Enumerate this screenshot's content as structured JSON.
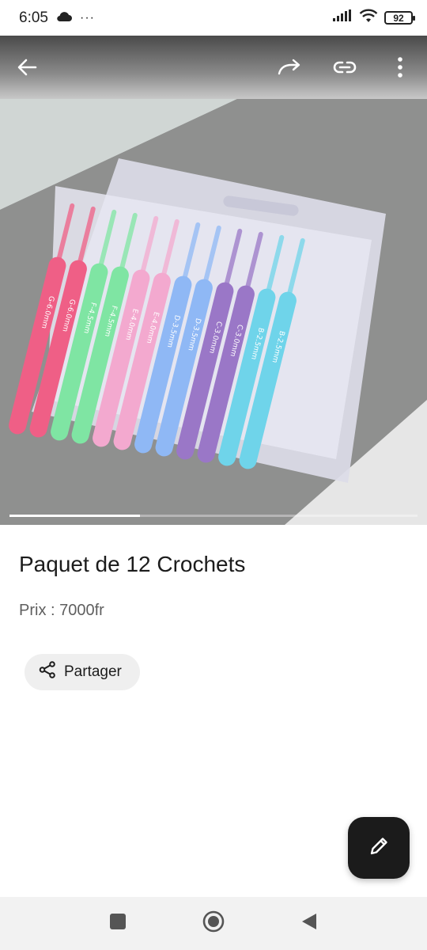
{
  "status_bar": {
    "time": "6:05",
    "overflow": "···",
    "battery": "92",
    "icons": [
      "cloud-icon",
      "signal-icon",
      "wifi-icon",
      "battery-icon"
    ]
  },
  "app_bar": {
    "icons": [
      "back-arrow-icon",
      "forward-icon",
      "link-icon",
      "more-vert-icon"
    ]
  },
  "hero": {
    "image": "crochet-hooks-pack-photo",
    "hook_labels": [
      "G-6.0mm",
      "G-6.0mm",
      "F-4.5mm",
      "F-4.5mm",
      "E-4.0mm",
      "E-4.0mm",
      "D-3.5mm",
      "D-3.5mm",
      "C-3.0mm",
      "C-3.0mm",
      "B-2.5mm",
      "B-2.5mm"
    ],
    "hook_colors": [
      "#ef5f86",
      "#ef5f86",
      "#7fe5a3",
      "#7fe5a3",
      "#f3a9cf",
      "#f3a9cf",
      "#8fb8f5",
      "#8fb8f5",
      "#9a77c7",
      "#9a77c7",
      "#6fd4ea",
      "#6fd4ea"
    ],
    "carousel_progress": 0.32
  },
  "product": {
    "title": "Paquet de 12 Crochets",
    "price": "Prix : 7000fr"
  },
  "share": {
    "label": "Partager",
    "icon": "share-icon"
  },
  "fab": {
    "icon": "pencil-edit-icon"
  },
  "nav_bar": {
    "icons": [
      "recents-square-icon",
      "home-circle-icon",
      "back-triangle-icon"
    ]
  }
}
